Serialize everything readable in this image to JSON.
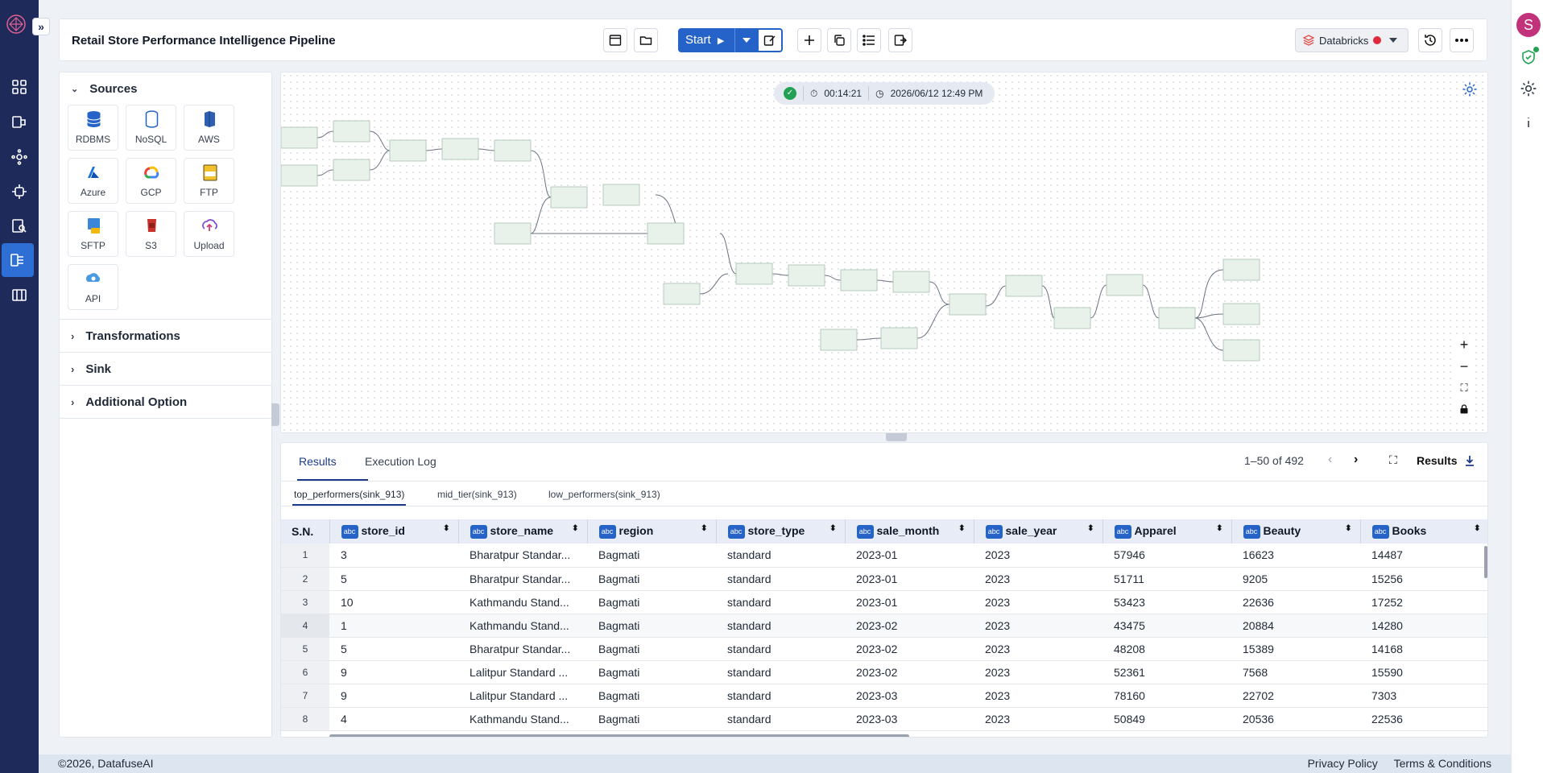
{
  "app": {
    "pipeline_title": "Retail Store Performance Intelligence Pipeline",
    "avatar_initial": "S"
  },
  "toolbar": {
    "start_label": "Start",
    "engine_label": "Databricks",
    "engine_status_color": "#e0293a"
  },
  "left_rail": {
    "items": [
      "dashboard-icon",
      "pipeline-icon",
      "graph-icon",
      "integrations-icon",
      "monitor-icon",
      "workflow-icon",
      "catalog-icon"
    ],
    "active_index": 5
  },
  "sources_panel": {
    "title": "Sources",
    "tiles": [
      {
        "label": "RDBMS",
        "icon": "database-icon"
      },
      {
        "label": "NoSQL",
        "icon": "nosql-icon"
      },
      {
        "label": "AWS",
        "icon": "aws-icon"
      },
      {
        "label": "Azure",
        "icon": "azure-icon"
      },
      {
        "label": "GCP",
        "icon": "gcp-icon"
      },
      {
        "label": "FTP",
        "icon": "ftp-icon"
      },
      {
        "label": "SFTP",
        "icon": "sftp-icon"
      },
      {
        "label": "S3",
        "icon": "s3-icon"
      },
      {
        "label": "Upload",
        "icon": "upload-icon"
      },
      {
        "label": "API",
        "icon": "api-icon"
      }
    ],
    "sections": [
      "Transformations",
      "Sink",
      "Additional Option"
    ]
  },
  "canvas": {
    "duration": "00:14:21",
    "run_datetime": "2026/06/12 12:49 PM"
  },
  "results": {
    "tabs": [
      "Results",
      "Execution Log"
    ],
    "active_tab": "Results",
    "pagination": "1–50 of 492",
    "results_label": "Results",
    "sink_tabs": [
      "top_performers(sink_913)",
      "mid_tier(sink_913)",
      "low_performers(sink_913)"
    ],
    "columns": [
      "S.N.",
      "store_id",
      "store_name",
      "region",
      "store_type",
      "sale_month",
      "sale_year",
      "Apparel",
      "Beauty",
      "Books"
    ],
    "column_type_label": "abc",
    "rows": [
      [
        "1",
        "3",
        "Bharatpur Standar...",
        "Bagmati",
        "standard",
        "2023-01",
        "2023",
        "57946",
        "16623",
        "14487"
      ],
      [
        "2",
        "5",
        "Bharatpur Standar...",
        "Bagmati",
        "standard",
        "2023-01",
        "2023",
        "51711",
        "9205",
        "15256"
      ],
      [
        "3",
        "10",
        "Kathmandu Stand...",
        "Bagmati",
        "standard",
        "2023-01",
        "2023",
        "53423",
        "22636",
        "17252"
      ],
      [
        "4",
        "1",
        "Kathmandu Stand...",
        "Bagmati",
        "standard",
        "2023-02",
        "2023",
        "43475",
        "20884",
        "14280"
      ],
      [
        "5",
        "5",
        "Bharatpur Standar...",
        "Bagmati",
        "standard",
        "2023-02",
        "2023",
        "48208",
        "15389",
        "14168"
      ],
      [
        "6",
        "9",
        "Lalitpur Standard ...",
        "Bagmati",
        "standard",
        "2023-02",
        "2023",
        "52361",
        "7568",
        "15590"
      ],
      [
        "7",
        "9",
        "Lalitpur Standard ...",
        "Bagmati",
        "standard",
        "2023-03",
        "2023",
        "78160",
        "22702",
        "7303"
      ],
      [
        "8",
        "4",
        "Kathmandu Stand...",
        "Bagmati",
        "standard",
        "2023-03",
        "2023",
        "50849",
        "20536",
        "22536"
      ]
    ]
  },
  "footer": {
    "copyright": "©2026, DatafuseAI",
    "privacy": "Privacy Policy",
    "terms": "Terms & Conditions"
  }
}
